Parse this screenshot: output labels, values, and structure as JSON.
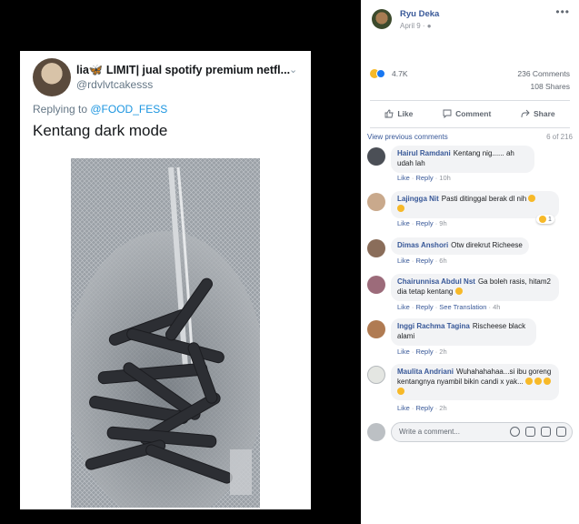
{
  "tweet": {
    "display_name": "lia🦋 LIMIT| jual spotify premium netfl...",
    "handle": "@rdvlvtcakesss",
    "reply_prefix": "Replying to ",
    "reply_to": "@FOOD_FESS",
    "text": "Kentang dark mode"
  },
  "post": {
    "author": "Ryu Deka",
    "date": "April 9 ·",
    "reactions_count": "4.7K",
    "comments_count": "236 Comments",
    "shares_count": "108 Shares",
    "actions": {
      "like": "Like",
      "comment": "Comment",
      "share": "Share"
    },
    "view_previous": "View previous comments",
    "comments_position": "6 of 216"
  },
  "comments": [
    {
      "author": "Hairul Ramdani",
      "text": "Kentang nig...... ah udah lah",
      "meta_like": "Like",
      "meta_reply": "Reply",
      "time": "10h"
    },
    {
      "author": "Lajingga Nit",
      "text": "Pasti ditinggal berak dl nih",
      "meta_like": "Like",
      "meta_reply": "Reply",
      "time": "9h",
      "reaction_count": "1"
    },
    {
      "author": "Dimas Anshori",
      "text": "Otw direkrut Richeese",
      "meta_like": "Like",
      "meta_reply": "Reply",
      "time": "6h"
    },
    {
      "author": "Chairunnisa Abdul Nst",
      "text": "Ga boleh rasis, hitam2 dia tetap kentang",
      "meta_like": "Like",
      "meta_reply": "Reply",
      "translation": "See Translation",
      "time": "4h"
    },
    {
      "author": "Inggi Rachma Tagina",
      "text": "Rischeese black alami",
      "meta_like": "Like",
      "meta_reply": "Reply",
      "time": "2h"
    },
    {
      "author": "Maulita Andriani",
      "text": "Wuhahahahaa...si ibu goreng kentangnya nyambil bikin candi x yak...",
      "meta_like": "Like",
      "meta_reply": "Reply",
      "time": "2h"
    }
  ],
  "composer": {
    "placeholder": "Write a comment..."
  },
  "colors": {
    "fb_link": "#385898",
    "tw_link": "#1b95e0",
    "bubble": "#f2f3f5"
  }
}
